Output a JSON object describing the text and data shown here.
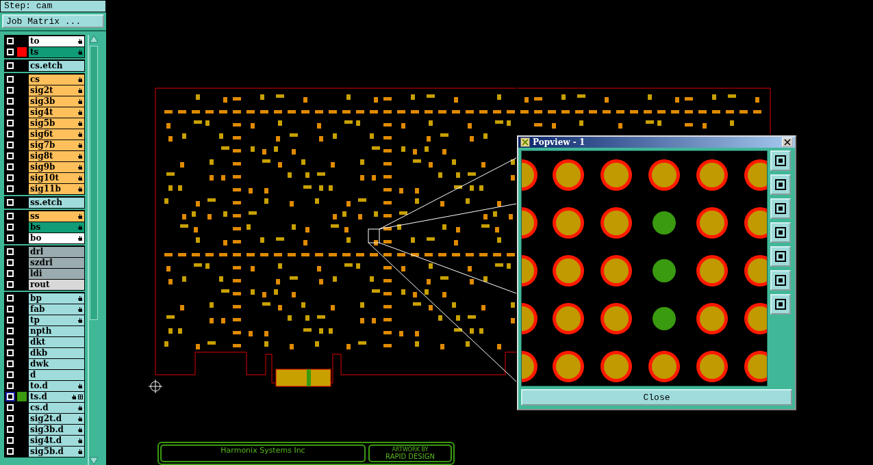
{
  "step": {
    "label": "Step: cam"
  },
  "job_matrix_button": "Job Matrix ...",
  "layer_groups": [
    {
      "layers": [
        {
          "name": "to",
          "kind": "silk",
          "hand": true,
          "selected": false
        },
        {
          "name": "ts",
          "kind": "mask",
          "color": "#ff0000",
          "hand": true,
          "selected": false
        }
      ]
    },
    {
      "layers": [
        {
          "name": "cs.etch",
          "kind": "document",
          "hand": false,
          "selected": false
        }
      ]
    },
    {
      "layers": [
        {
          "name": "cs",
          "kind": "signal",
          "hand": true,
          "selected": false
        },
        {
          "name": "sig2t",
          "kind": "signal",
          "hand": true,
          "selected": false
        },
        {
          "name": "sig3b",
          "kind": "signal",
          "hand": true,
          "selected": false
        },
        {
          "name": "sig4t",
          "kind": "signal",
          "hand": true,
          "selected": false
        },
        {
          "name": "sig5b",
          "kind": "signal",
          "hand": true,
          "selected": false
        },
        {
          "name": "sig6t",
          "kind": "signal",
          "hand": true,
          "selected": false
        },
        {
          "name": "sig7b",
          "kind": "signal",
          "hand": true,
          "selected": false
        },
        {
          "name": "sig8t",
          "kind": "signal",
          "hand": true,
          "selected": false
        },
        {
          "name": "sig9b",
          "kind": "signal",
          "hand": true,
          "selected": false
        },
        {
          "name": "sig10t",
          "kind": "signal",
          "hand": true,
          "selected": false
        },
        {
          "name": "sig11b",
          "kind": "signal",
          "hand": true,
          "selected": false
        }
      ]
    },
    {
      "layers": [
        {
          "name": "ss.etch",
          "kind": "document",
          "hand": false,
          "selected": false
        }
      ]
    },
    {
      "layers": [
        {
          "name": "ss",
          "kind": "signal",
          "hand": true,
          "selected": false
        },
        {
          "name": "bs",
          "kind": "mask",
          "hand": true,
          "selected": false
        },
        {
          "name": "bo",
          "kind": "silk",
          "hand": true,
          "selected": false
        }
      ]
    },
    {
      "layers": [
        {
          "name": "drl",
          "kind": "drill",
          "hand": false,
          "selected": false
        },
        {
          "name": "szdrl",
          "kind": "drill",
          "hand": false,
          "selected": false
        },
        {
          "name": "ldi",
          "kind": "drill",
          "hand": false,
          "selected": false
        },
        {
          "name": "rout",
          "kind": "rout",
          "hand": false,
          "selected": false
        }
      ]
    },
    {
      "layers": [
        {
          "name": "bp",
          "kind": "document",
          "hand": true,
          "selected": false
        },
        {
          "name": "fab",
          "kind": "document",
          "hand": true,
          "selected": false
        },
        {
          "name": "tp",
          "kind": "document",
          "hand": true,
          "selected": false
        },
        {
          "name": "npth",
          "kind": "document",
          "hand": false,
          "selected": false
        },
        {
          "name": "dkt",
          "kind": "document",
          "hand": false,
          "selected": false
        },
        {
          "name": "dkb",
          "kind": "document",
          "hand": false,
          "selected": false
        },
        {
          "name": "dwk",
          "kind": "document",
          "hand": false,
          "selected": false
        },
        {
          "name": "d",
          "kind": "document",
          "hand": false,
          "selected": false
        },
        {
          "name": "to.d",
          "kind": "document",
          "hand": true,
          "selected": false
        },
        {
          "name": "ts.d",
          "kind": "document",
          "color": "#3a9a10",
          "hand": true,
          "grid": true,
          "selected": true
        },
        {
          "name": "cs.d",
          "kind": "document",
          "hand": true,
          "selected": false
        },
        {
          "name": "sig2t.d",
          "kind": "document",
          "hand": true,
          "selected": false
        },
        {
          "name": "sig3b.d",
          "kind": "document",
          "hand": true,
          "selected": false
        },
        {
          "name": "sig4t.d",
          "kind": "document",
          "hand": true,
          "selected": false
        },
        {
          "name": "sig5b.d",
          "kind": "document",
          "hand": true,
          "selected": false
        }
      ]
    }
  ],
  "title_block": {
    "company": "Harmonix Systems Inc",
    "artwork_label": "ARTWORK BY",
    "artwork_by": "RAPID DESIGN"
  },
  "popview": {
    "title": "Popview - 1",
    "close_button": "Close"
  }
}
